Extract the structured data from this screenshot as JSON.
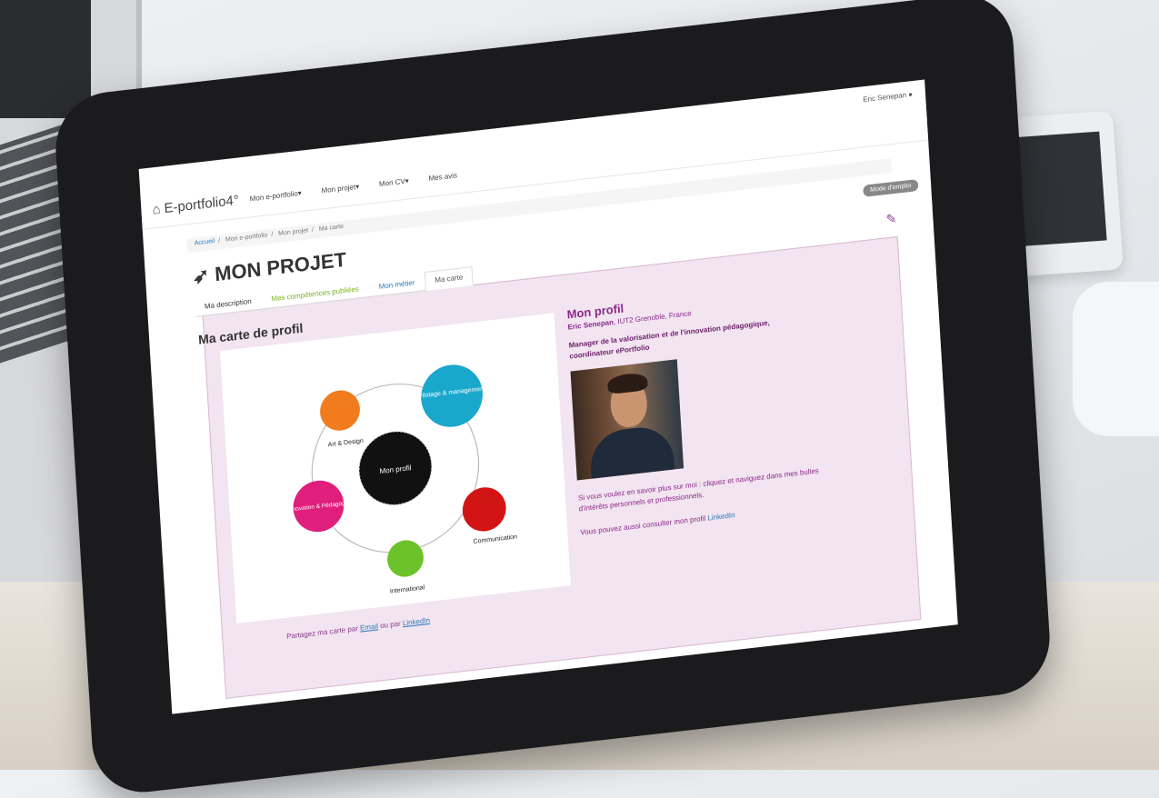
{
  "header": {
    "user_menu": "Eric Senepan"
  },
  "navbar": {
    "brand": "E-portfolio4°",
    "items": [
      "Mon e-portfolio▾",
      "Mon projet▾",
      "Mon CV▾",
      "Mes avis"
    ]
  },
  "breadcrumb": [
    "Accueil",
    "Mon e-portfolio",
    "Mon projet",
    "Ma carte"
  ],
  "page": {
    "title": "MON PROJET",
    "badge": "Mode d'emploi"
  },
  "tabs": [
    {
      "label": "Ma description",
      "active": false
    },
    {
      "label": "Mes compétences publiées",
      "active": false
    },
    {
      "label": "Mon métier",
      "active": false
    },
    {
      "label": "Ma carte",
      "active": true
    }
  ],
  "map_section": {
    "title": "Ma carte de profil",
    "center_label": "Mon profil",
    "nodes": [
      {
        "label": "Pilotage & management",
        "color": "#1aa7cc"
      },
      {
        "label": "Art & Design",
        "color": "#f07c1e"
      },
      {
        "label": "Innovation & Pédagogie",
        "color": "#e01e7c"
      },
      {
        "label": "International",
        "color": "#6cc22a"
      },
      {
        "label": "Communication",
        "color": "#d21414"
      }
    ],
    "share_prefix": "Partagez ma carte par",
    "share_link1": "Email",
    "share_mid": "ou par",
    "share_link2": "LinkedIn"
  },
  "profile": {
    "title": "Mon profil",
    "name": "Eric Senepan",
    "affiliation": "IUT2 Grenoble, France",
    "role": "Manager de la valorisation et de l'innovation pédagogique, coordinateur ePortfolio",
    "text1": "Si vous voulez en savoir plus sur moi : cliquez et naviguez dans mes bulles d'intérêts personnels et professionnels.",
    "text2_prefix": "Vous pouvez aussi consulter mon profil",
    "text2_link": "LinkedIn"
  },
  "accent_colors": {
    "purple": "#8a2a8a",
    "panel_bg": "#f2e4f0",
    "link": "#2a7ab8"
  }
}
